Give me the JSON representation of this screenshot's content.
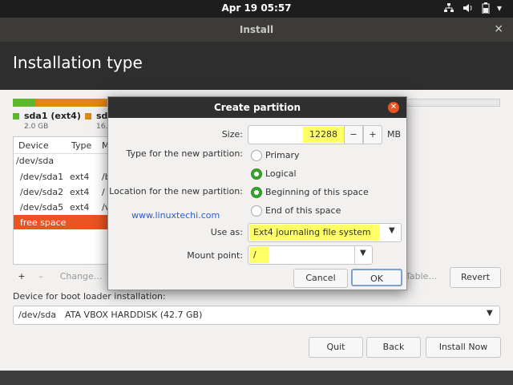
{
  "system": {
    "clock": "Apr 19  05:57",
    "tray_icons": [
      "network-icon",
      "volume-icon",
      "battery-icon"
    ]
  },
  "window": {
    "title": "Install",
    "close_glyph": "×",
    "page_title": "Installation type"
  },
  "legend": [
    {
      "label": "sda1 (ext4)",
      "size": "2.0 GB",
      "color": "#5cb82a"
    },
    {
      "label": "sd",
      "size": "16.",
      "color": "#e08614"
    }
  ],
  "table": {
    "headers": [
      "Device",
      "Type",
      "M"
    ],
    "rows": [
      {
        "device": "/dev/sda",
        "type": "",
        "mount": ""
      },
      {
        "device": "/dev/sda1",
        "type": "ext4",
        "mount": "/b"
      },
      {
        "device": "/dev/sda2",
        "type": "ext4",
        "mount": "/"
      },
      {
        "device": "/dev/sda5",
        "type": "ext4",
        "mount": "/v"
      },
      {
        "device": "free space",
        "type": "",
        "mount": ""
      }
    ]
  },
  "table_buttons": {
    "add": "+",
    "remove": "–",
    "change": "Change...",
    "new_table": "Table...",
    "revert": "Revert"
  },
  "boot": {
    "label": "Device for boot loader installation:",
    "device": "/dev/sda",
    "description": "ATA VBOX HARDDISK (42.7 GB)"
  },
  "footer_buttons": {
    "quit": "Quit",
    "back": "Back",
    "install": "Install Now"
  },
  "dialog": {
    "title": "Create partition",
    "size_label": "Size:",
    "size_value": "12288",
    "size_unit": "MB",
    "minus": "−",
    "plus": "+",
    "type_label": "Type for the new partition:",
    "type_options": [
      "Primary",
      "Logical"
    ],
    "type_selected": "Logical",
    "location_label": "Location for the new partition:",
    "location_options": [
      "Beginning of this space",
      "End of this space"
    ],
    "location_selected": "Beginning of this space",
    "watermark": "www.linuxtechi.com",
    "use_as_label": "Use as:",
    "use_as_value": "Ext4 journaling file system",
    "mount_label": "Mount point:",
    "mount_value": "/",
    "cancel": "Cancel",
    "ok": "OK",
    "highlight_color": "#ffff66"
  },
  "colors": {
    "accent": "#e95420",
    "radio_on": "#3aa12f"
  }
}
